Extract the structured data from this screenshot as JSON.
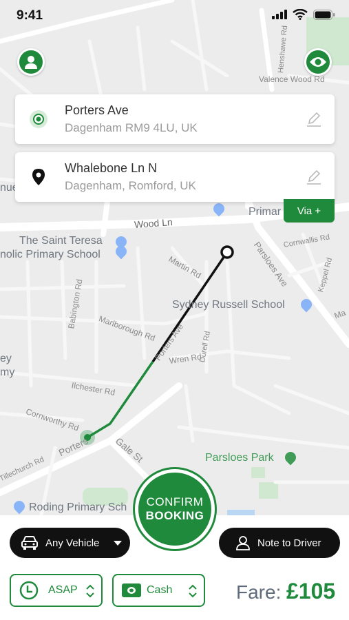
{
  "status": {
    "time": "9:41"
  },
  "pickup": {
    "title": "Porters Ave",
    "subtitle": "Dagenham RM9 4LU, UK"
  },
  "dropoff": {
    "title": "Whalebone Ln N",
    "subtitle": "Dagenham, Romford, UK"
  },
  "via_label": "Via +",
  "map_labels": {
    "wood_ln": "Wood Ln",
    "the_saint_teresa": "The Saint Teresa",
    "primary_school_partial": "nolic Primary School",
    "primar_partial": "Primar",
    "sydney_russell": "Sydney Russell School",
    "parsloes_ave": "Parsloes Ave",
    "martin_rd": "Martin Rd",
    "babington_rd": "Babington Rd",
    "marlborough_rd": "Marlborough Rd",
    "porters_ave_road": "Porters Ave",
    "wren_rd": "Wren Rd",
    "durell_rd": "Durell Rd",
    "ilchester_rd": "Ilchester Rd",
    "cornworthy_rd": "Cornworthy Rd",
    "porters_road_lower": "Porters",
    "gale_st": "Gale St",
    "parsloes_park": "Parsloes Park",
    "roding_primary": "Roding Primary Sch",
    "cornwallis_rd": "Cornwallis Rd",
    "keppel_rd": "Keppel Rd",
    "valence_wood_rd": "Valence Wood Rd",
    "henshawe_rd": "Henshawe Rd",
    "tillechurch_rd": "Tillechurch Rd",
    "ey_partial": "ey",
    "my_partial": "my",
    "nue_partial": "nue",
    "ma_partial": "Ma"
  },
  "confirm": {
    "line1": "CONFIRM",
    "line2": "BOOKING"
  },
  "vehicle": {
    "label": "Any Vehicle"
  },
  "note": {
    "label": "Note to Driver"
  },
  "time_select": {
    "value": "ASAP"
  },
  "payment_select": {
    "value": "Cash"
  },
  "fare": {
    "label": "Fare:",
    "value": "£105"
  },
  "colors": {
    "accent": "#1f8a3b",
    "dark": "#111111",
    "map_bg": "#ececec"
  }
}
